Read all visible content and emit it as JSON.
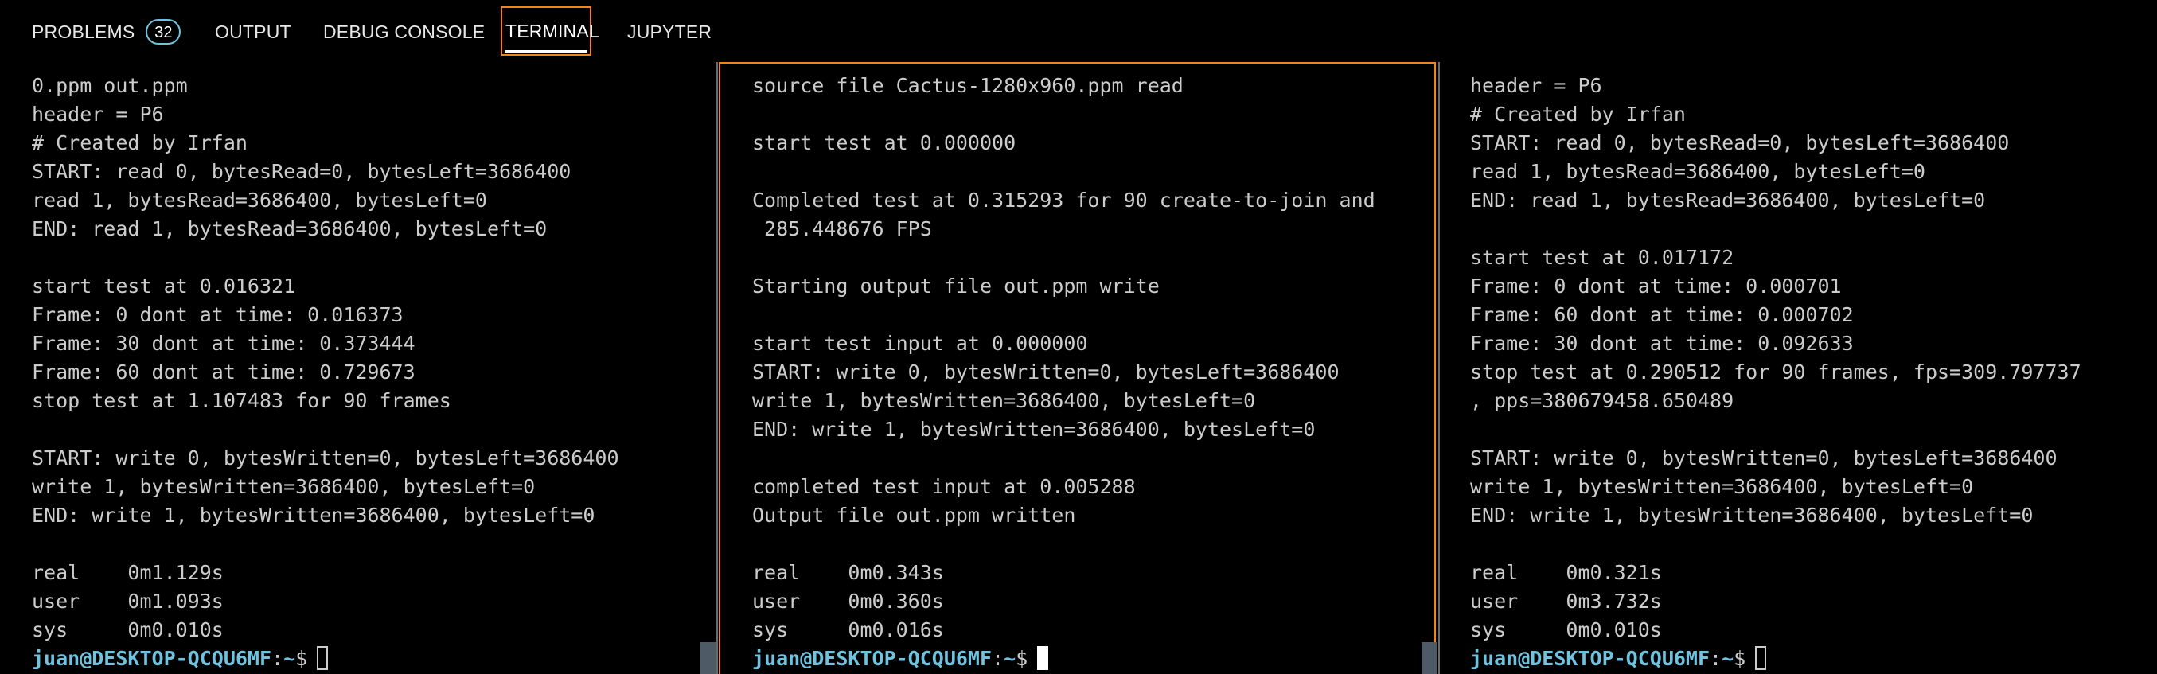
{
  "tabs": {
    "problems": {
      "label": "PROBLEMS",
      "count": "32"
    },
    "output": {
      "label": "OUTPUT"
    },
    "debug_console": {
      "label": "DEBUG CONSOLE"
    },
    "terminal": {
      "label": "TERMINAL",
      "active": true
    },
    "jupyter": {
      "label": "JUPYTER"
    }
  },
  "colors": {
    "focus_border": "#f38518",
    "prompt": "#6fc3df",
    "text": "#cccccc",
    "background": "#000000"
  },
  "panes": {
    "left": {
      "lines": [
        "0.ppm out.ppm",
        "header = P6",
        "# Created by Irfan",
        "START: read 0, bytesRead=0, bytesLeft=3686400",
        "read 1, bytesRead=3686400, bytesLeft=0",
        "END: read 1, bytesRead=3686400, bytesLeft=0",
        "",
        "start test at 0.016321",
        "Frame: 0 dont at time: 0.016373",
        "Frame: 30 dont at time: 0.373444",
        "Frame: 60 dont at time: 0.729673",
        "stop test at 1.107483 for 90 frames",
        "",
        "START: write 0, bytesWritten=0, bytesLeft=3686400",
        "write 1, bytesWritten=3686400, bytesLeft=0",
        "END: write 1, bytesWritten=3686400, bytesLeft=0",
        "",
        "real    0m1.129s",
        "user    0m1.093s",
        "sys     0m0.010s"
      ],
      "prompt": {
        "user_host": "juan@DESKTOP-QCQU6MF",
        "sep": ":",
        "path": "~",
        "symbol": "$"
      }
    },
    "middle": {
      "lines": [
        "source file Cactus-1280x960.ppm read",
        "",
        "start test at 0.000000",
        "",
        "Completed test at 0.315293 for 90 create-to-join and",
        " 285.448676 FPS",
        "",
        "Starting output file out.ppm write",
        "",
        "start test input at 0.000000",
        "START: write 0, bytesWritten=0, bytesLeft=3686400",
        "write 1, bytesWritten=3686400, bytesLeft=0",
        "END: write 1, bytesWritten=3686400, bytesLeft=0",
        "",
        "completed test input at 0.005288",
        "Output file out.ppm written",
        "",
        "real    0m0.343s",
        "user    0m0.360s",
        "sys     0m0.016s"
      ],
      "prompt": {
        "user_host": "juan@DESKTOP-QCQU6MF",
        "sep": ":",
        "path": "~",
        "symbol": "$"
      }
    },
    "right": {
      "lines": [
        "header = P6",
        "# Created by Irfan",
        "START: read 0, bytesRead=0, bytesLeft=3686400",
        "read 1, bytesRead=3686400, bytesLeft=0",
        "END: read 1, bytesRead=3686400, bytesLeft=0",
        "",
        "start test at 0.017172",
        "Frame: 0 dont at time: 0.000701",
        "Frame: 60 dont at time: 0.000702",
        "Frame: 30 dont at time: 0.092633",
        "stop test at 0.290512 for 90 frames, fps=309.797737",
        ", pps=380679458.650489",
        "",
        "START: write 0, bytesWritten=0, bytesLeft=3686400",
        "write 1, bytesWritten=3686400, bytesLeft=0",
        "END: write 1, bytesWritten=3686400, bytesLeft=0",
        "",
        "real    0m0.321s",
        "user    0m3.732s",
        "sys     0m0.010s"
      ],
      "prompt": {
        "user_host": "juan@DESKTOP-QCQU6MF",
        "sep": ":",
        "path": "~",
        "symbol": "$"
      }
    }
  }
}
